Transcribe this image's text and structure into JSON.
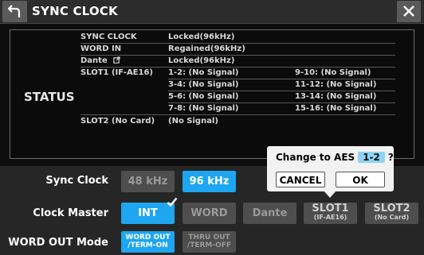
{
  "window": {
    "title": "SYNC CLOCK"
  },
  "status": {
    "heading": "STATUS",
    "rows": [
      {
        "label": "SYNC CLOCK",
        "value": "Locked(96kHz)"
      },
      {
        "label": "WORD IN",
        "value": "Regained(96kHz)"
      },
      {
        "label": "Dante",
        "value": "Locked(96kHz)"
      }
    ],
    "slot1": {
      "label": "SLOT1 (IF-AE16)",
      "left": [
        "1-2: (No Signal)",
        "3-4: (No Signal)",
        "5-6: (No Signal)",
        "7-8: (No Signal)"
      ],
      "right": [
        "9-10: (No Signal)",
        "11-12: (No Signal)",
        "13-14: (No Signal)",
        "15-16: (No Signal)"
      ]
    },
    "slot2": {
      "label": "SLOT2 (No Card)",
      "value": "(No Signal)"
    }
  },
  "sync_clock": {
    "label": "Sync Clock",
    "options": [
      "48 kHz",
      "96 kHz"
    ],
    "selected": "96 kHz"
  },
  "clock_master": {
    "label": "Clock Master",
    "options": {
      "int": "INT",
      "word": "WORD",
      "dante": "Dante",
      "slot1": "SLOT1",
      "slot1_sub": "(IF-AE16)",
      "slot2": "SLOT2",
      "slot2_sub": "(No Card)"
    },
    "selected": "INT"
  },
  "word_out": {
    "label": "WORD OUT Mode",
    "opt1_l1": "WORD OUT",
    "opt1_l2": "/TERM-ON",
    "opt2_l1": "THRU OUT",
    "opt2_l2": "/TERM-OFF",
    "selected": "WORD OUT /TERM-ON"
  },
  "popup": {
    "message": "Change to AES",
    "slot": "1-2",
    "question": "?",
    "cancel": "CANCEL",
    "ok": "OK"
  },
  "colors": {
    "accent": "#1ea6f0",
    "popup_highlight": "#8fd3f5"
  },
  "icons": {
    "back": "back-arrow-icon",
    "close": "close-icon",
    "link": "link-icon",
    "check": "checkmark-icon"
  }
}
